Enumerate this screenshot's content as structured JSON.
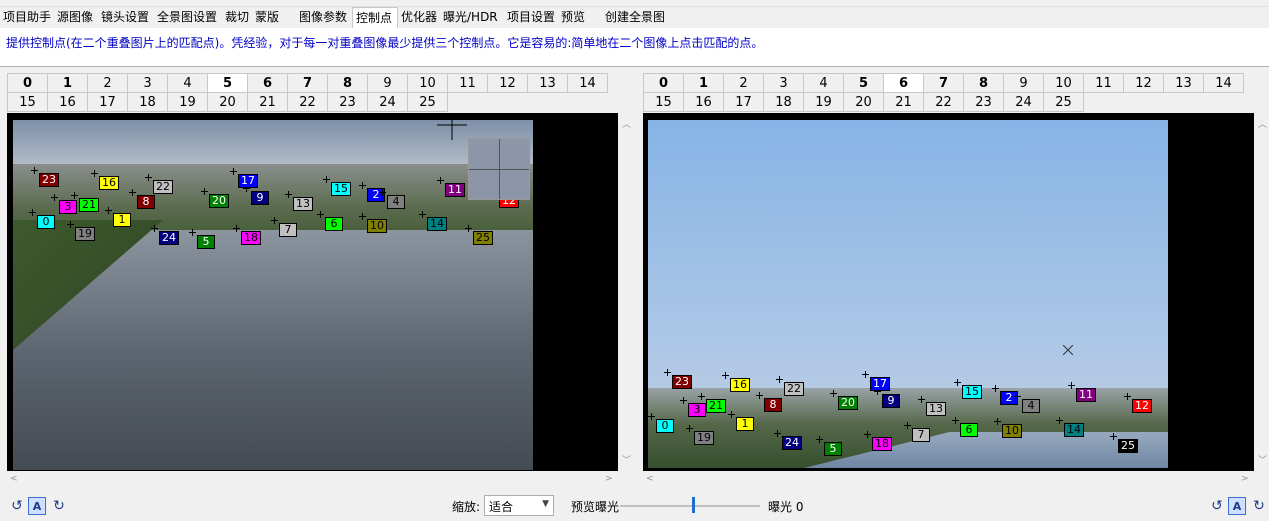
{
  "tabs": [
    {
      "label": "项目助手"
    },
    {
      "label": "源图像"
    },
    {
      "label": "镜头设置"
    },
    {
      "label": "全景图设置"
    },
    {
      "label": "裁切"
    },
    {
      "label": "蒙版"
    },
    {
      "label": "图像参数"
    },
    {
      "label": "控制点",
      "active": true
    },
    {
      "label": "优化器"
    },
    {
      "label": "曝光/HDR"
    },
    {
      "label": "项目设置"
    },
    {
      "label": "预览"
    },
    {
      "label": "创建全景图"
    }
  ],
  "info_text": "提供控制点(在二个重叠图片上的匹配点)。凭经验，对于每一对重叠图像最少提供三个控制点。它是容易的:简单地在二个图像上点击匹配的点。",
  "left_image_tabs": [
    "0",
    "1",
    "2",
    "3",
    "4",
    "5",
    "6",
    "7",
    "8",
    "9",
    "10",
    "11",
    "12",
    "13",
    "14",
    "15",
    "16",
    "17",
    "18",
    "19",
    "20",
    "21",
    "22",
    "23",
    "24",
    "25"
  ],
  "left_selected": "5",
  "right_image_tabs": [
    "0",
    "1",
    "2",
    "3",
    "4",
    "5",
    "6",
    "7",
    "8",
    "9",
    "10",
    "11",
    "12",
    "13",
    "14",
    "15",
    "16",
    "17",
    "18",
    "19",
    "20",
    "21",
    "22",
    "23",
    "24",
    "25"
  ],
  "right_selected": "6",
  "bold_tabs": [
    "0",
    "1",
    "5",
    "6",
    "7",
    "8"
  ],
  "control_points": [
    {
      "id": "0",
      "color": "#00ffff",
      "text": "#000"
    },
    {
      "id": "1",
      "color": "#ffff00",
      "text": "#000"
    },
    {
      "id": "2",
      "color": "#0000ff",
      "text": "#fff"
    },
    {
      "id": "3",
      "color": "#ff00ff",
      "text": "#000"
    },
    {
      "id": "4",
      "color": "#808080",
      "text": "#000"
    },
    {
      "id": "5",
      "color": "#008000",
      "text": "#fff"
    },
    {
      "id": "6",
      "color": "#00ff00",
      "text": "#000"
    },
    {
      "id": "7",
      "color": "#c0c0c0",
      "text": "#000"
    },
    {
      "id": "8",
      "color": "#800000",
      "text": "#fff"
    },
    {
      "id": "9",
      "color": "#000080",
      "text": "#fff"
    },
    {
      "id": "10",
      "color": "#808000",
      "text": "#000"
    },
    {
      "id": "11",
      "color": "#800080",
      "text": "#fff"
    },
    {
      "id": "12",
      "color": "#ff0000",
      "text": "#fff"
    },
    {
      "id": "13",
      "color": "#c0c0c0",
      "text": "#000"
    },
    {
      "id": "14",
      "color": "#008080",
      "text": "#000"
    },
    {
      "id": "15",
      "color": "#00ffff",
      "text": "#000"
    },
    {
      "id": "16",
      "color": "#ffff00",
      "text": "#000"
    },
    {
      "id": "17",
      "color": "#0000ff",
      "text": "#fff"
    },
    {
      "id": "18",
      "color": "#ff00ff",
      "text": "#000"
    },
    {
      "id": "19",
      "color": "#808080",
      "text": "#000"
    },
    {
      "id": "20",
      "color": "#008000",
      "text": "#fff"
    },
    {
      "id": "21",
      "color": "#00ff00",
      "text": "#000"
    },
    {
      "id": "22",
      "color": "#c0c0c0",
      "text": "#000"
    },
    {
      "id": "23",
      "color": "#800000",
      "text": "#fff"
    },
    {
      "id": "24",
      "color": "#000080",
      "text": "#fff"
    },
    {
      "id": "25",
      "color": "#808000",
      "text": "#000"
    }
  ],
  "right_extra": {
    "25": {
      "color": "#000000",
      "text": "#fff"
    }
  },
  "bottom": {
    "zoom_label": "缩放:",
    "zoom_value": "适合",
    "preview_exposure_label": "预览曝光",
    "exposure_label": "曝光 0"
  },
  "icons": {
    "rotate_left": "rotate-left-icon",
    "auto": "A",
    "rotate_right": "rotate-right-icon"
  }
}
